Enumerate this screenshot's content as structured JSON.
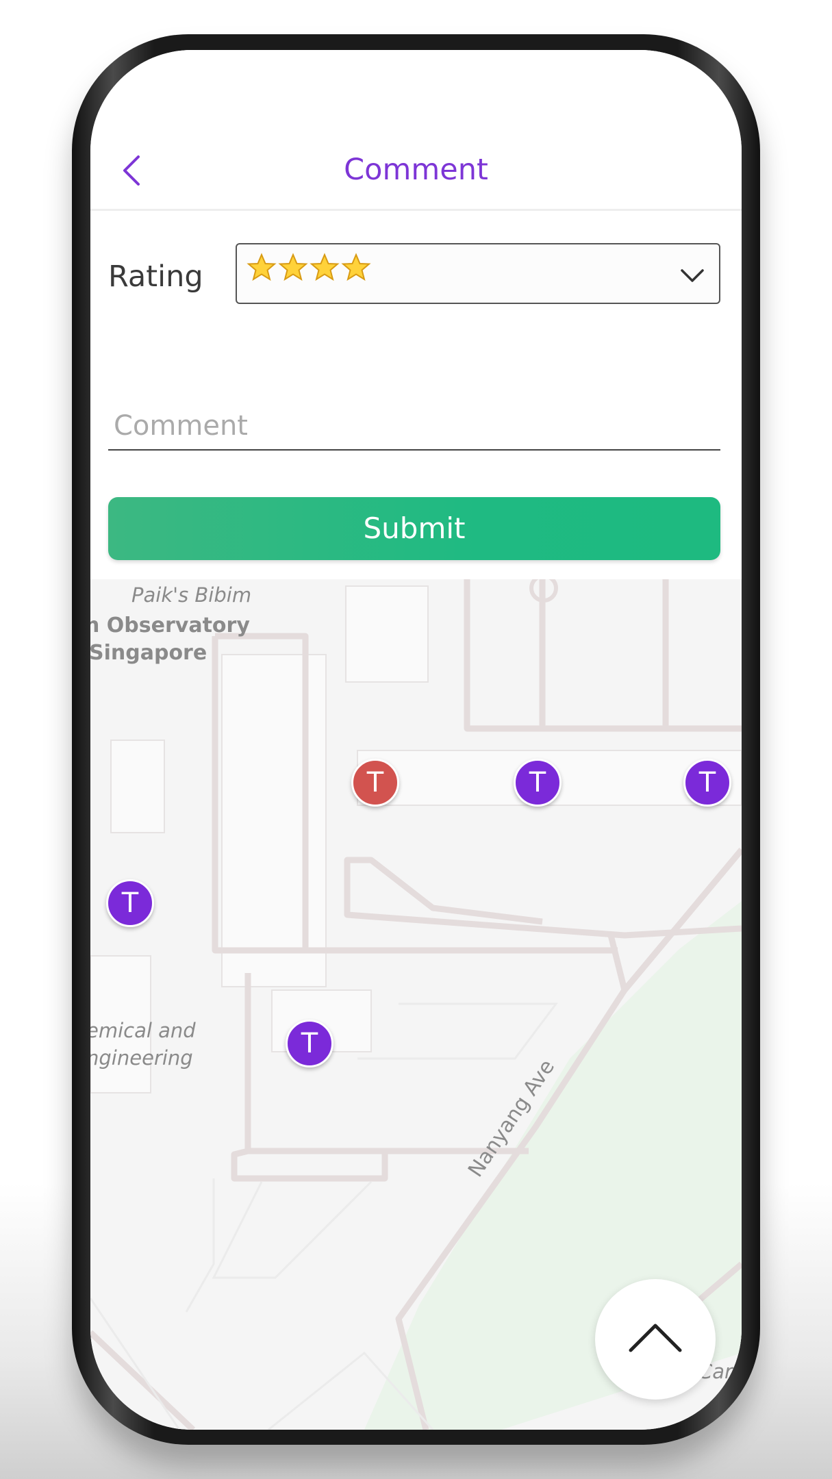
{
  "header": {
    "title": "Comment",
    "back_icon": "chevron-left-icon"
  },
  "form": {
    "rating_label": "Rating",
    "rating_value": 4,
    "rating_max": 4,
    "rating_icon": "star-icon",
    "dropdown_icon": "chevron-down-icon",
    "comment_placeholder": "Comment",
    "comment_value": "",
    "submit_label": "Submit"
  },
  "map": {
    "labels": {
      "place1": "Paik's Bibim",
      "place2_line1": "n Observatory",
      "place2_line2": "Singapore",
      "place3_line1": "emical and",
      "place3_line2": "ngineering",
      "road": "Nanyang Ave",
      "edge": "Car P"
    },
    "markers": [
      {
        "label": "T",
        "color": "#d2534f",
        "state": "selected"
      },
      {
        "label": "T",
        "color": "#7b2ad9",
        "state": "default"
      },
      {
        "label": "T",
        "color": "#7b2ad9",
        "state": "default"
      },
      {
        "label": "T",
        "color": "#7b2ad9",
        "state": "default"
      },
      {
        "label": "T",
        "color": "#7b2ad9",
        "state": "default"
      }
    ]
  },
  "scroll_up_icon": "chevron-up-icon",
  "colors": {
    "accent": "#7d35d6",
    "submit": "#1fba82",
    "marker_default": "#7b2ad9",
    "marker_selected": "#d2534f"
  }
}
